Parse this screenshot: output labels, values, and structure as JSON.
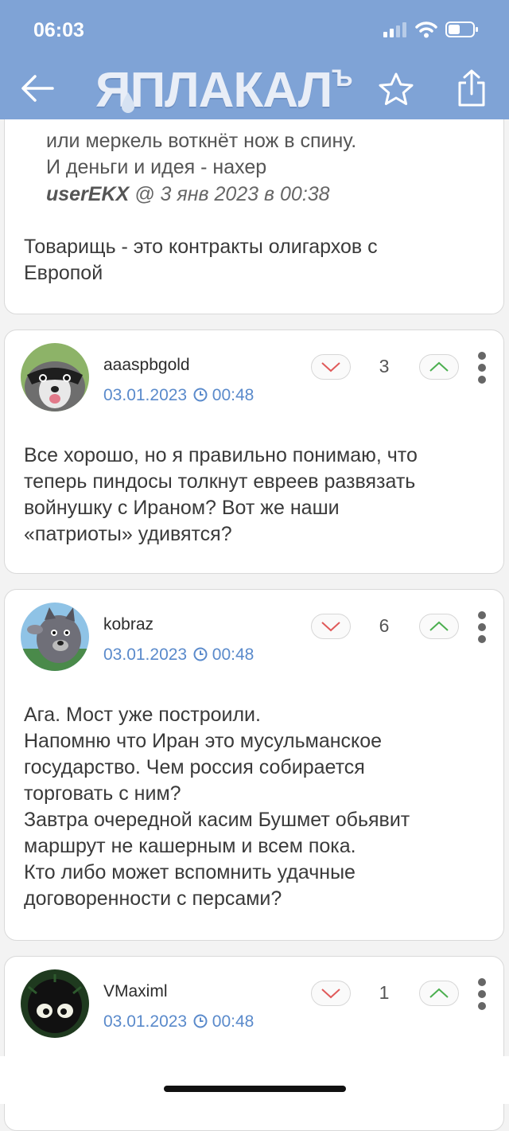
{
  "status_bar": {
    "time": "06:03"
  },
  "header": {
    "logo_main": "ЯПЛАКАЛ",
    "logo_sup": "Ъ"
  },
  "prev_comment": {
    "quote_lines": [
      "или меркель воткнёт нож в спину.",
      "И деньги и идея - нахер"
    ],
    "quote_author": "userEKX",
    "quote_meta": "@ 3 янв 2023 в 00:38",
    "text_lines": [
      "Товарищь - это контракты олигархов с",
      "Европой"
    ]
  },
  "comments": [
    {
      "username": "aaaspbgold",
      "date": "03.01.2023",
      "time": "00:48",
      "score": "3",
      "text_lines": [
        "Все хорошо, но я правильно понимаю, что",
        "теперь пиндосы толкнут евреев развязать",
        "войнушку с Ираном? Вот же наши",
        "«патриоты» удивятся?"
      ]
    },
    {
      "username": "kobraz",
      "date": "03.01.2023",
      "time": "00:48",
      "score": "6",
      "text_lines": [
        "Ага. Мост уже построили.",
        "Напомню что Иран это мусульманское",
        "государство. Чем россия собирается",
        "торговать с ним?",
        "Завтра очередной касим Бушмет обьявит",
        "маршрут не кашерным и всем пока.",
        "Кто либо может вспомнить удачные",
        "договоренности с персами?"
      ]
    },
    {
      "username": "VMaximl",
      "date": "03.01.2023",
      "time": "00:48",
      "score": "1"
    }
  ],
  "colors": {
    "header": "#7fa3d6",
    "date": "#5a8acb",
    "vote_down": "#e05a5a",
    "vote_up": "#4caf50"
  }
}
